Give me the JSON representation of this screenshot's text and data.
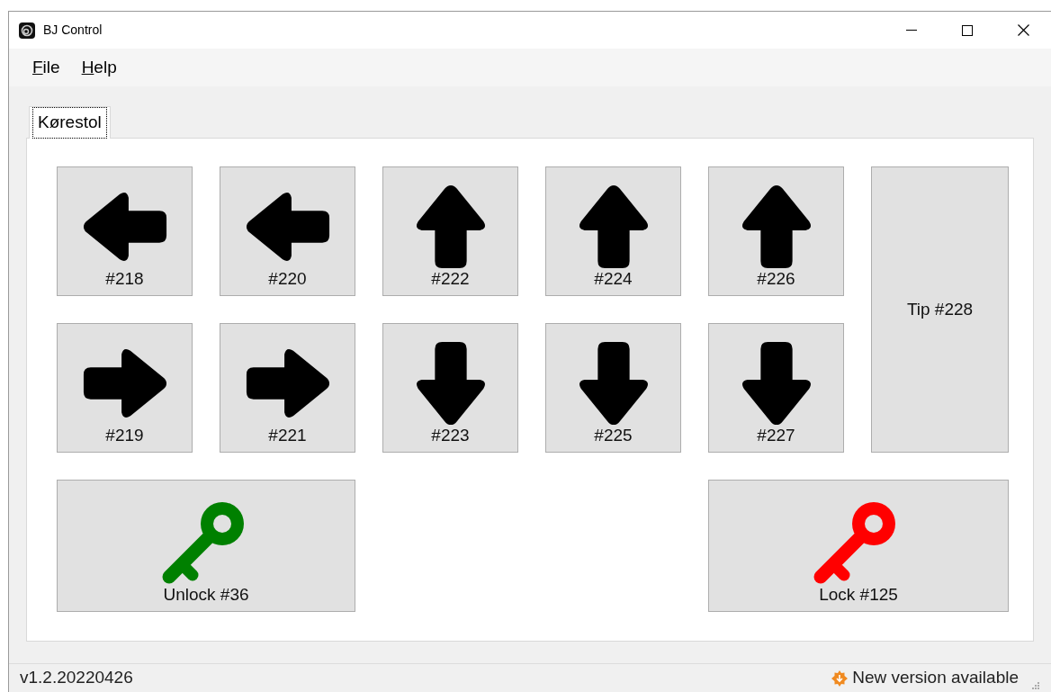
{
  "window": {
    "title": "BJ Control"
  },
  "menu": [
    {
      "label": "File"
    },
    {
      "label": "Help"
    }
  ],
  "tabs": [
    {
      "label": "Kørestol",
      "selected": true
    }
  ],
  "buttons": [
    {
      "kind": "left",
      "label": "#218"
    },
    {
      "kind": "left",
      "label": "#220"
    },
    {
      "kind": "up",
      "label": "#222"
    },
    {
      "kind": "up",
      "label": "#224"
    },
    {
      "kind": "up",
      "label": "#226"
    },
    {
      "kind": "text",
      "label": "Tip #228"
    },
    {
      "kind": "right",
      "label": "#219"
    },
    {
      "kind": "right",
      "label": "#221"
    },
    {
      "kind": "down",
      "label": "#223"
    },
    {
      "kind": "down",
      "label": "#225"
    },
    {
      "kind": "down",
      "label": "#227"
    },
    {
      "kind": "key",
      "color": "#008000",
      "label": "Unlock #36"
    },
    {
      "kind": "key",
      "color": "#ff0000",
      "label": "Lock #125"
    }
  ],
  "status_bar": {
    "version": "v1.2.20220426",
    "notice": "New version available"
  }
}
